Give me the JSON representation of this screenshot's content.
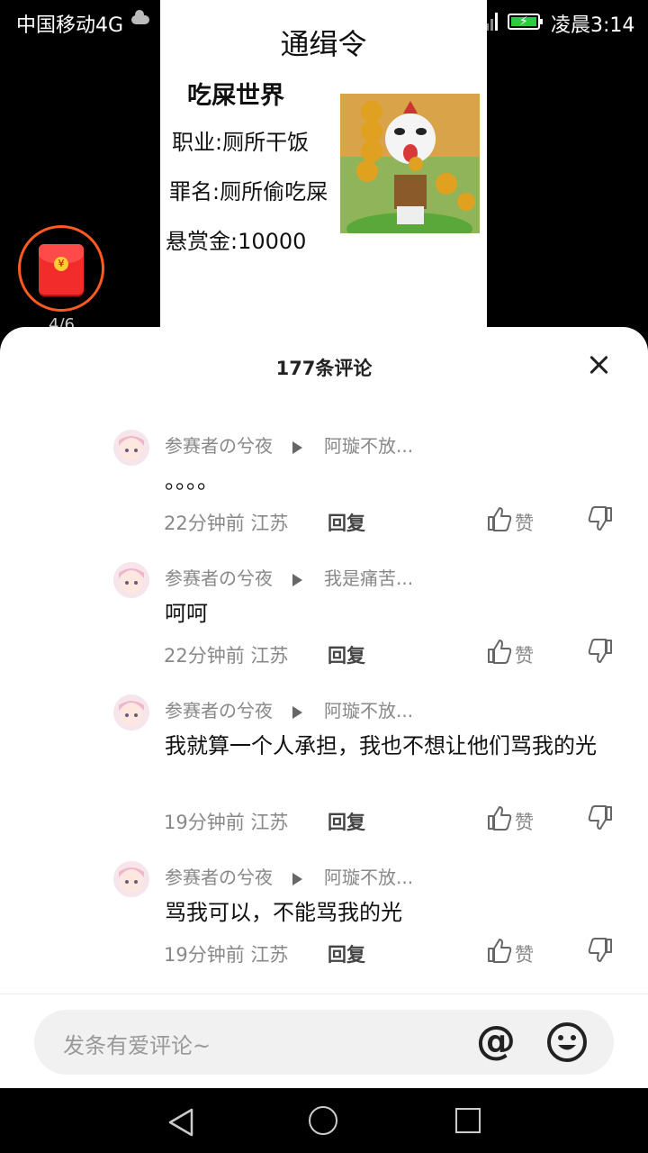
{
  "status_bar": {
    "carrier": "中国移动4G",
    "time": "凌晨3:14",
    "battery_color": "#2ecc40"
  },
  "poster": {
    "title": "通缉令",
    "name": "吃屎世界",
    "job": "职业:厕所干饭",
    "crime": "罪名:厕所偷吃屎",
    "bounty": "悬赏金:10000"
  },
  "red_packet": {
    "count": "4/6",
    "accent": "#ff5a1f"
  },
  "comments_sheet": {
    "title": "177条评论",
    "comments": [
      {
        "author": "参赛者の兮夜",
        "reply_to": "阿璇不放...",
        "text": "。。。。",
        "time_location": "22分钟前  江苏",
        "reply_label": "回复",
        "like_label": "赞"
      },
      {
        "author": "参赛者の兮夜",
        "reply_to": "我是痛苦...",
        "text": "呵呵",
        "time_location": "22分钟前  江苏",
        "reply_label": "回复",
        "like_label": "赞"
      },
      {
        "author": "参赛者の兮夜",
        "reply_to": "阿璇不放...",
        "text": "我就算一个人承担，我也不想让他们骂我的光",
        "time_location": "19分钟前  江苏",
        "reply_label": "回复",
        "like_label": "赞"
      },
      {
        "author": "参赛者の兮夜",
        "reply_to": "阿璇不放...",
        "text": "骂我可以，不能骂我的光",
        "time_location": "19分钟前  江苏",
        "reply_label": "回复",
        "like_label": "赞"
      }
    ]
  },
  "input_bar": {
    "placeholder": "发条有爱评论~",
    "at_symbol": "@"
  }
}
